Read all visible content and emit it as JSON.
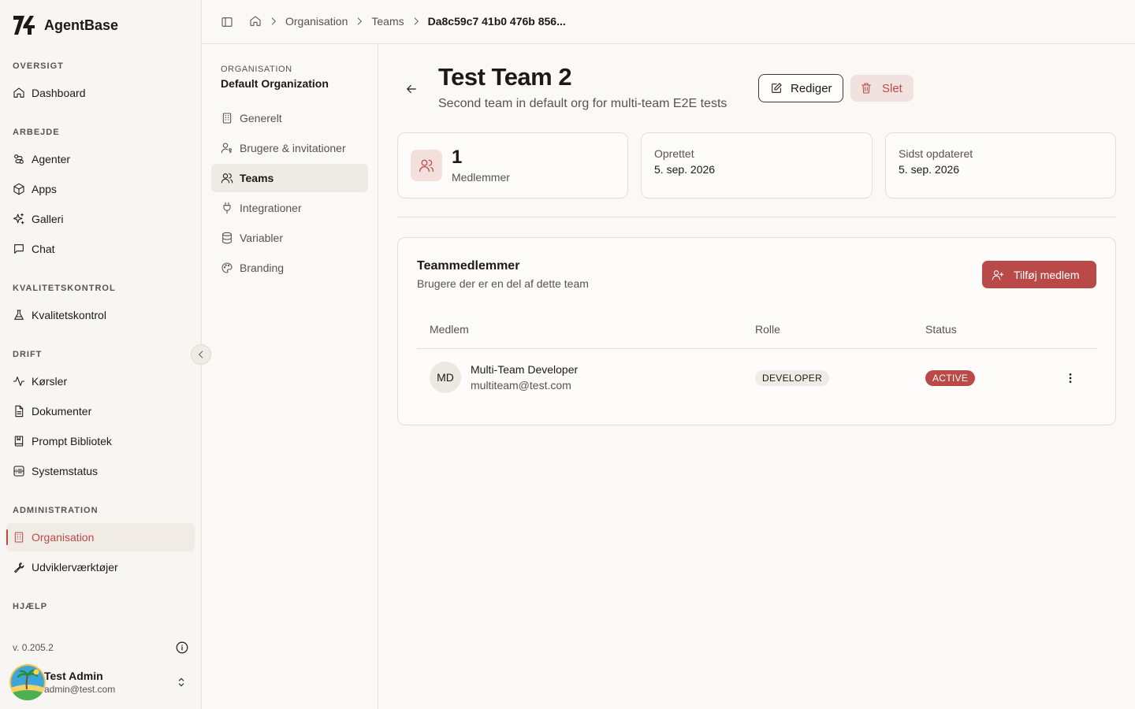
{
  "brand": {
    "name": "AgentBase"
  },
  "sidebar": {
    "sections": [
      {
        "label": "OVERSIGT"
      },
      {
        "label": "ARBEJDE"
      },
      {
        "label": "KVALITETSKONTROL"
      },
      {
        "label": "DRIFT"
      },
      {
        "label": "ADMINISTRATION"
      },
      {
        "label": "HJÆLP"
      }
    ],
    "items": [
      {
        "label": "Dashboard",
        "icon": "home-icon"
      },
      {
        "label": "Agenter",
        "icon": "agents-icon"
      },
      {
        "label": "Apps",
        "icon": "box-icon"
      },
      {
        "label": "Galleri",
        "icon": "sparkles-icon"
      },
      {
        "label": "Chat",
        "icon": "chat-icon"
      },
      {
        "label": "Kvalitetskontrol",
        "icon": "flask-icon"
      },
      {
        "label": "Kørsler",
        "icon": "activity-icon"
      },
      {
        "label": "Dokumenter",
        "icon": "document-icon"
      },
      {
        "label": "Prompt Bibliotek",
        "icon": "book-icon"
      },
      {
        "label": "Systemstatus",
        "icon": "server-icon"
      },
      {
        "label": "Organisation",
        "icon": "building-icon",
        "active": true
      },
      {
        "label": "Udviklerværktøjer",
        "icon": "wrench-icon"
      }
    ],
    "version": "v. 0.205.2",
    "user": {
      "name": "Test Admin",
      "email": "admin@test.com"
    }
  },
  "breadcrumb": [
    "Organisation",
    "Teams",
    "Da8c59c7 41b0 476b 856..."
  ],
  "org_nav": {
    "overline": "ORGANISATION",
    "org_name": "Default Organization",
    "items": [
      {
        "label": "Generelt",
        "icon": "building-icon"
      },
      {
        "label": "Brugere & invitationer",
        "icon": "user-key-icon"
      },
      {
        "label": "Teams",
        "icon": "users-icon",
        "active": true
      },
      {
        "label": "Integrationer",
        "icon": "plug-icon"
      },
      {
        "label": "Variabler",
        "icon": "database-icon"
      },
      {
        "label": "Branding",
        "icon": "palette-icon"
      }
    ]
  },
  "team": {
    "title": "Test Team 2",
    "description": "Second team in default org for multi-team E2E tests",
    "edit_label": "Rediger",
    "delete_label": "Slet"
  },
  "stats": {
    "members_count": "1",
    "members_label": "Medlemmer",
    "created_label": "Oprettet",
    "created_value": "5. sep. 2026",
    "updated_label": "Sidst opdateret",
    "updated_value": "5. sep. 2026"
  },
  "members_card": {
    "title": "Teammedlemmer",
    "subtitle": "Brugere der er en del af dette team",
    "add_label": "Tilføj medlem",
    "columns": [
      "Medlem",
      "Rolle",
      "Status"
    ],
    "rows": [
      {
        "initials": "MD",
        "name": "Multi-Team Developer",
        "email": "multiteam@test.com",
        "role": "DEVELOPER",
        "status": "ACTIVE"
      }
    ]
  },
  "colors": {
    "accent": "#b94a48",
    "background": "#fbf9f6",
    "sidebar": "#f8f6f2"
  }
}
